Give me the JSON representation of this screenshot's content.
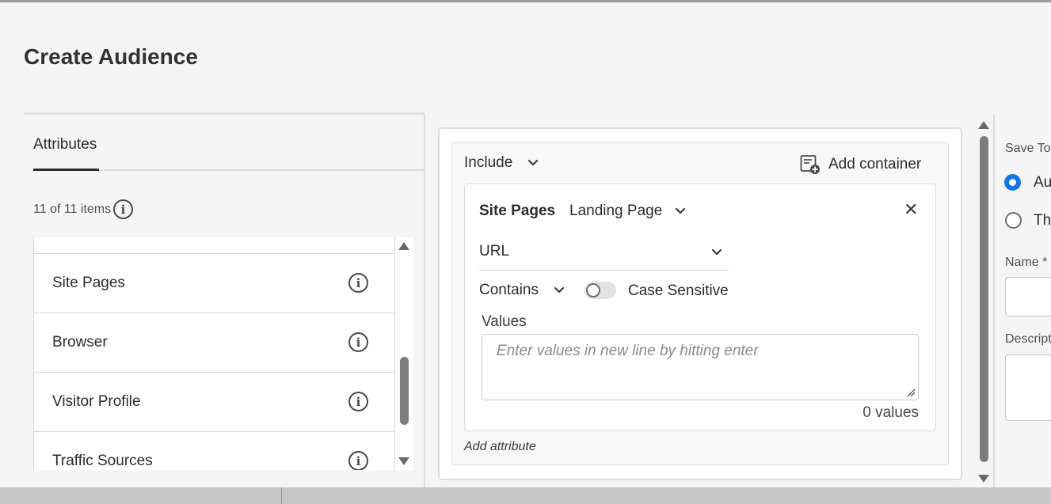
{
  "page": {
    "title": "Create Audience"
  },
  "attributes_panel": {
    "tab_label": "Attributes",
    "item_count": "11 of 11 items",
    "items": [
      {
        "label": "Site Pages"
      },
      {
        "label": "Browser"
      },
      {
        "label": "Visitor Profile"
      },
      {
        "label": "Traffic Sources"
      }
    ]
  },
  "builder": {
    "include_label": "Include",
    "add_container_label": "Add container",
    "rule": {
      "category": "Site Pages",
      "attribute": "Landing Page",
      "field": "URL",
      "operator": "Contains",
      "case_sensitive_label": "Case Sensitive",
      "case_sensitive_on": false,
      "values_label": "Values",
      "values_placeholder": "Enter values in new line by hitting enter",
      "values_count": "0 values"
    },
    "add_attribute_label": "Add attribute"
  },
  "save_panel": {
    "save_to_label": "Save To",
    "option_1": "Au",
    "option_2": "Th",
    "name_label": "Name *",
    "description_label": "Descript"
  },
  "colors": {
    "accent": "#1473e6"
  },
  "icons": {
    "info": "info-icon",
    "chevron": "chevron-down-icon",
    "close": "close-icon",
    "add_container": "add-container-icon"
  }
}
